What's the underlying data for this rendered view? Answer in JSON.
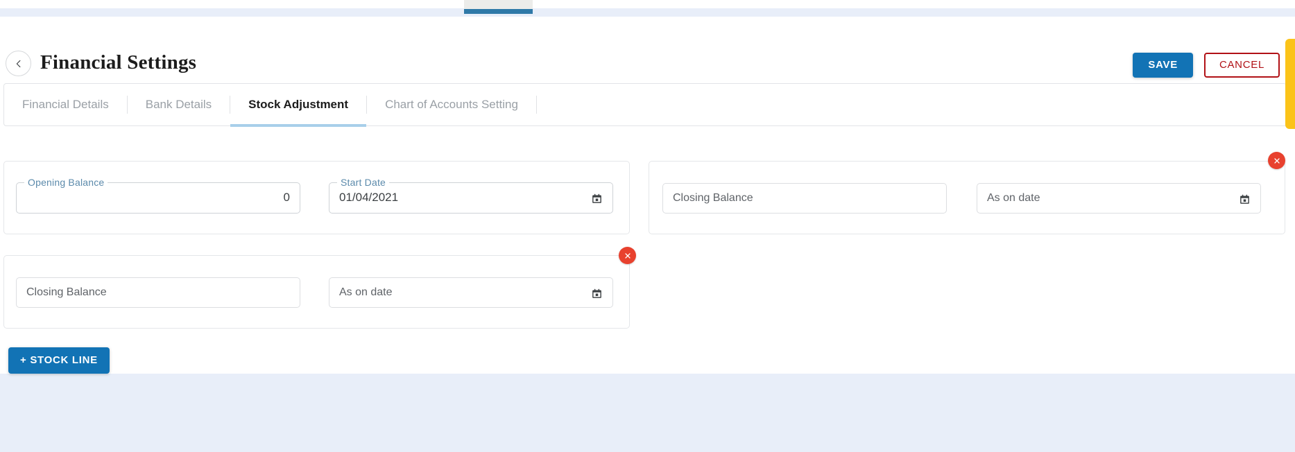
{
  "header": {
    "title": "Financial Settings",
    "back_icon": "chevron-left-icon",
    "save_label": "SAVE",
    "cancel_label": "CANCEL"
  },
  "tabs": [
    {
      "label": "Financial Details",
      "active": false
    },
    {
      "label": "Bank Details",
      "active": false
    },
    {
      "label": "Stock Adjustment",
      "active": true
    },
    {
      "label": "Chart of Accounts Setting",
      "active": false
    }
  ],
  "stock_adjustment": {
    "opening_row": {
      "opening_balance": {
        "label": "Opening Balance",
        "value": "0"
      },
      "start_date": {
        "label": "Start Date",
        "value": "01/04/2021",
        "icon": "calendar-icon"
      }
    },
    "lines": [
      {
        "closing_balance_placeholder": "Closing Balance",
        "closing_balance_value": "",
        "as_on_date_placeholder": "As on date",
        "as_on_date_value": "",
        "date_icon": "calendar-icon",
        "delete_icon": "close-icon"
      },
      {
        "closing_balance_placeholder": "Closing Balance",
        "closing_balance_value": "",
        "as_on_date_placeholder": "As on date",
        "as_on_date_value": "",
        "date_icon": "calendar-icon",
        "delete_icon": "close-icon"
      }
    ],
    "add_line_label": "+ STOCK LINE"
  },
  "colors": {
    "primary_blue": "#1273b5",
    "cancel_red": "#b11116",
    "delete_red": "#e8412e",
    "active_tab_underline": "#a8cfea",
    "label_blue": "#5b8aab",
    "page_background": "#e8eef9",
    "toast_yellow": "#fbc319"
  }
}
